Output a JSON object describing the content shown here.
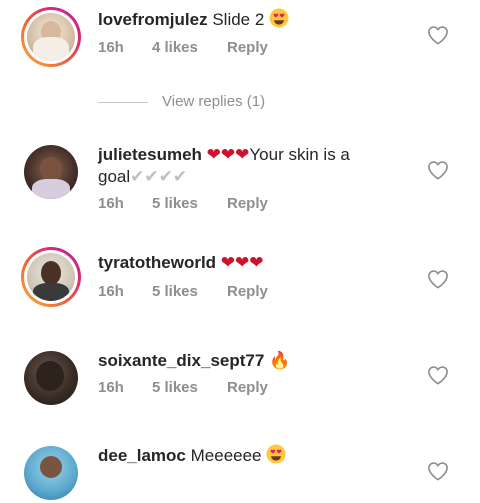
{
  "comments": [
    {
      "username": "lovefromjulez",
      "text": "Slide 2",
      "emoji": "heart-eyes-emoji",
      "time": "16h",
      "likes": "4 likes",
      "reply": "Reply"
    },
    {
      "username": "julietesumeh",
      "text_prefix": "❤❤❤",
      "text": "Your skin is a goal",
      "text_suffix": "✔✔✔✔",
      "time": "16h",
      "likes": "5 likes",
      "reply": "Reply"
    },
    {
      "username": "tyratotheworld",
      "text": "❤❤❤",
      "time": "16h",
      "likes": "5 likes",
      "reply": "Reply"
    },
    {
      "username": "soixante_dix_sept77",
      "text": "🔥",
      "time": "16h",
      "likes": "5 likes",
      "reply": "Reply"
    },
    {
      "username": "dee_lamoc",
      "text": "Meeeeee",
      "emoji": "heart-eyes-emoji"
    }
  ],
  "view_replies": "View replies (1)",
  "colors": {
    "meta": "#8e8e8e",
    "username": "#262626",
    "heart_emoji": "#d0112b"
  }
}
